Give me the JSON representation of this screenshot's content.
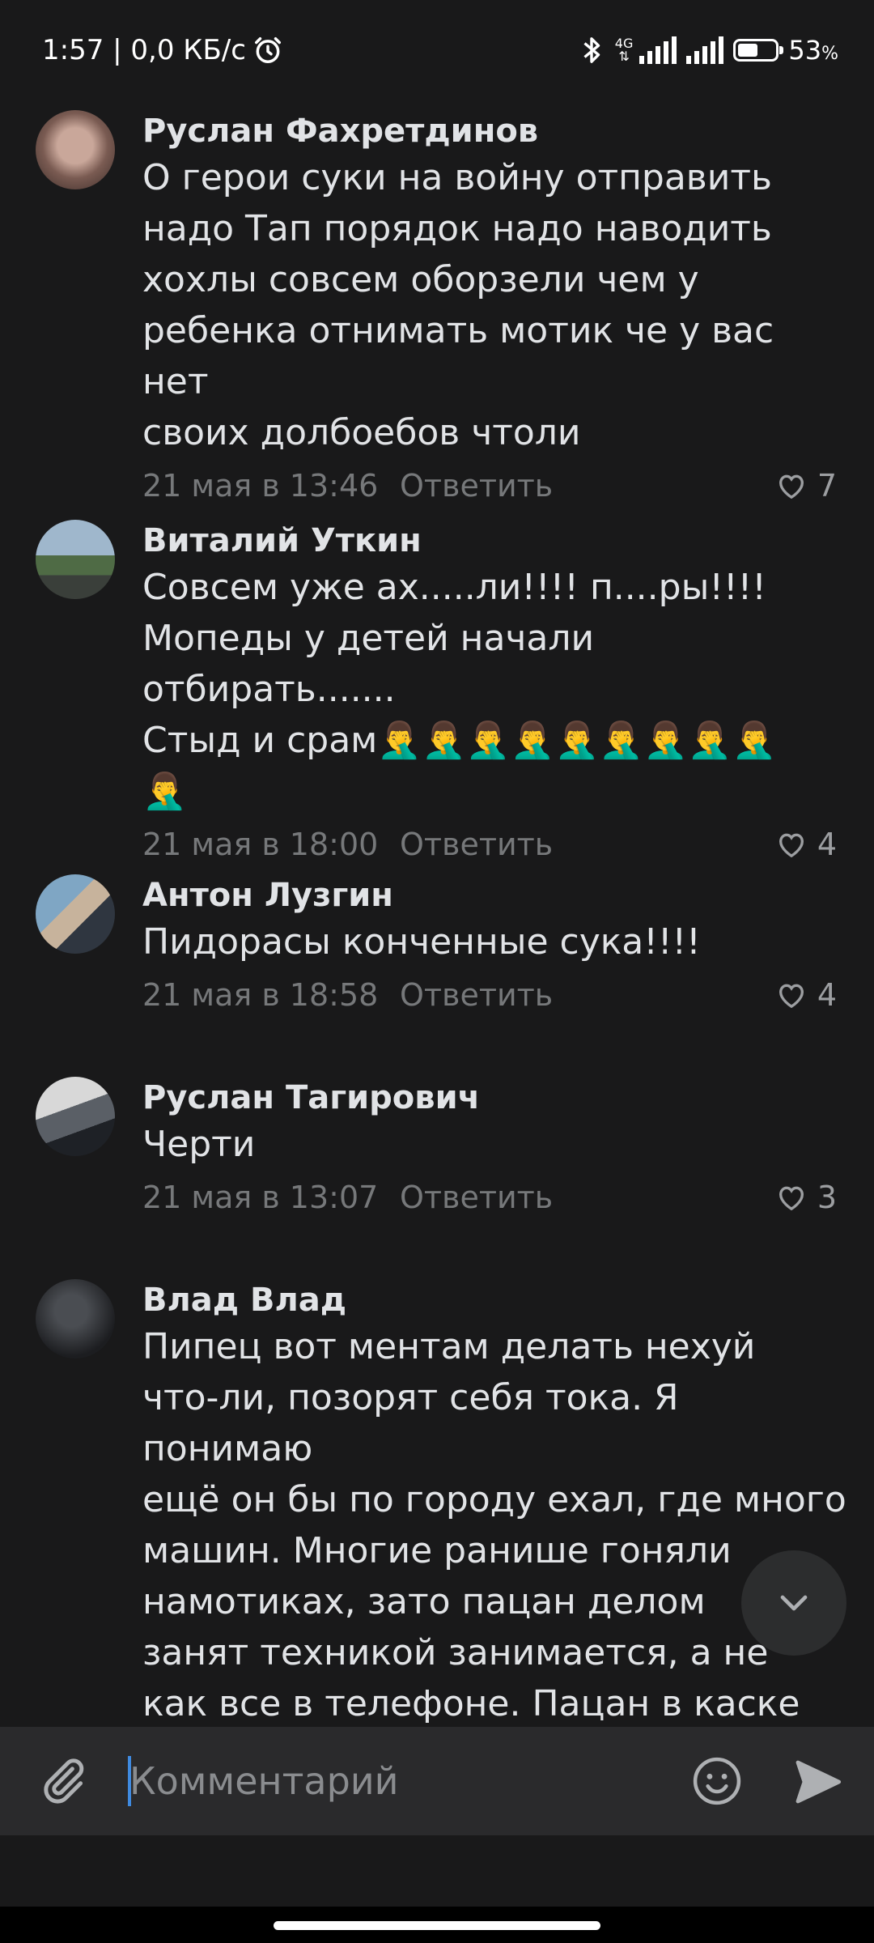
{
  "status_bar": {
    "time_speed": "1:57 | 0,0 КБ/с",
    "network": "4G",
    "battery": "53",
    "battery_unit": "%",
    "icons": [
      "alarm-icon",
      "bluetooth-icon",
      "signal-icon",
      "battery-icon"
    ]
  },
  "comments": [
    {
      "author": "Руслан Фахретдинов",
      "text": "О герои суки на войну отправить\nнадо Тап порядок надо наводить\nхохлы совсем оборзели чем у\nребенка отнимать мотик че у вас нет\nсвоих долбоебов чтоли",
      "date": "21 мая в 13:46",
      "reply_label": "Ответить",
      "likes": "7"
    },
    {
      "author": "Виталий Уткин",
      "text": "Совсем уже ах.....ли!!!! п....ры!!!!\nМопеды у детей начали отбирать.......\nСтыд и срам🤦‍♂️🤦‍♂️🤦‍♂️🤦‍♂️🤦‍♂️🤦‍♂️🤦‍♂️🤦‍♂️🤦‍♂️\n🤦‍♂️",
      "date": "21 мая в 18:00",
      "reply_label": "Ответить",
      "likes": "4"
    },
    {
      "author": "Антон Лузгин",
      "text": "Пидорасы конченные сука!!!!",
      "date": "21 мая в 18:58",
      "reply_label": "Ответить",
      "likes": "4"
    },
    {
      "author": "Руслан Тагирович",
      "text": "Черти",
      "date": "21 мая в 13:07",
      "reply_label": "Ответить",
      "likes": "3"
    },
    {
      "author": "Влад Влад",
      "text": "Пипец вот ментам делать нехуй\nчто-ли, позорят себя тока. Я понимаю\nещё он бы по городу ехал, где много\nмашин. Многие ранише гоняли\nнамотиках, зато пацан делом\nзанят техникой занимается, а не\nкак все в телефоне. Пацан в каске",
      "date": "",
      "reply_label": "",
      "likes": ""
    }
  ],
  "composer": {
    "placeholder": "Комментарий"
  },
  "colors": {
    "background": "#19191a",
    "composer_bg": "#2a2a2c",
    "text": "#e1e3e6",
    "meta": "#76787a",
    "accent_caret": "#3f8ae0"
  }
}
